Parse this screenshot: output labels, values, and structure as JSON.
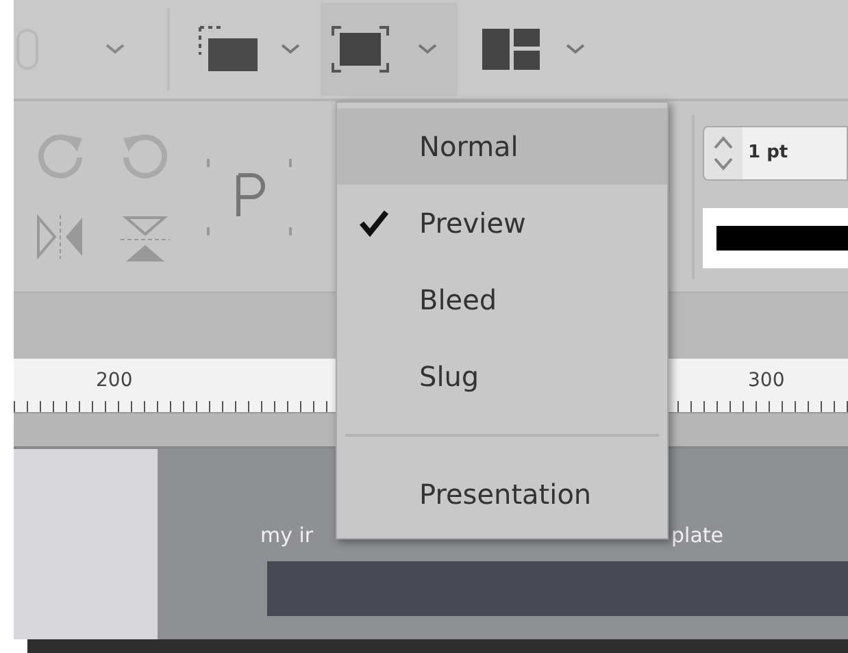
{
  "view_menu": {
    "items": [
      {
        "label": "Normal",
        "checked": false,
        "selected": true,
        "divider_before": false
      },
      {
        "label": "Preview",
        "checked": true,
        "selected": false,
        "divider_before": false
      },
      {
        "label": "Bleed",
        "checked": false,
        "selected": false,
        "divider_before": false
      },
      {
        "label": "Slug",
        "checked": false,
        "selected": false,
        "divider_before": false
      },
      {
        "label": "Presentation",
        "checked": false,
        "selected": false,
        "divider_before": true
      }
    ]
  },
  "stroke": {
    "weight": "1 pt"
  },
  "ruler": {
    "labels": [
      "200",
      "300"
    ]
  },
  "canvas": {
    "texts": [
      "my ir",
      "plate"
    ]
  }
}
